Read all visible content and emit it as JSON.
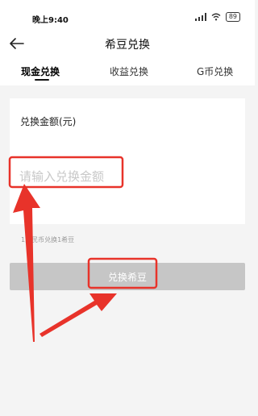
{
  "status_bar": {
    "time": "晚上9:40",
    "signal_icon": "signal-icon",
    "wifi_icon": "wifi-icon",
    "battery": "89"
  },
  "header": {
    "title": "希豆兑换",
    "back_icon": "back-arrow-icon"
  },
  "tabs": [
    {
      "label": "现金兑换",
      "active": true
    },
    {
      "label": "收益兑换",
      "active": false
    },
    {
      "label": "G币兑换",
      "active": false
    }
  ],
  "form": {
    "label": "兑换金额(元)",
    "placeholder": "请输入兑换金额",
    "rate_text": "1人民币兑换1希豆",
    "submit_label": "兑换希豆"
  },
  "colors": {
    "annotation_red": "#e8332a",
    "button_disabled": "#c6c6c6",
    "page_bg": "#f4f4f4"
  }
}
